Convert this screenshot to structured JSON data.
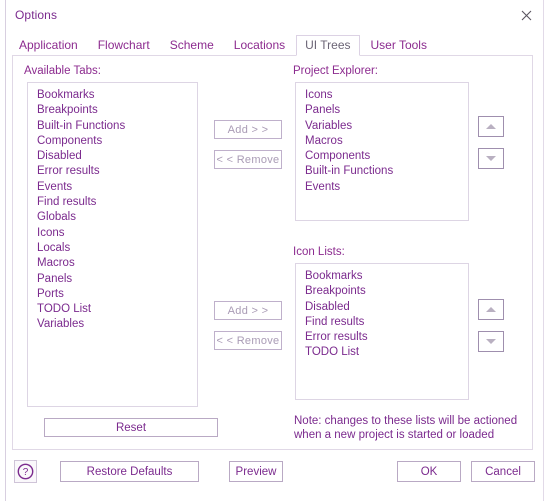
{
  "window": {
    "title": "Options",
    "close_icon": "close-icon"
  },
  "tabs": [
    {
      "label": "Application",
      "selected": false
    },
    {
      "label": "Flowchart",
      "selected": false
    },
    {
      "label": "Scheme",
      "selected": false
    },
    {
      "label": "Locations",
      "selected": false
    },
    {
      "label": "UI Trees",
      "selected": true
    },
    {
      "label": "User Tools",
      "selected": false
    }
  ],
  "available_tabs": {
    "label": "Available Tabs:",
    "items": [
      "Bookmarks",
      "Breakpoints",
      "Built-in Functions",
      "Components",
      "Disabled",
      "Error results",
      "Events",
      "Find results",
      "Globals",
      "Icons",
      "Locals",
      "Macros",
      "Panels",
      "Ports",
      "TODO List",
      "Variables"
    ],
    "reset_label": "Reset"
  },
  "project_explorer": {
    "label": "Project Explorer:",
    "items": [
      "Icons",
      "Panels",
      "Variables",
      "Macros",
      "Components",
      "Built-in Functions",
      "Events"
    ],
    "add_label": "Add > >",
    "remove_label": "< < Remove",
    "move_up_icon": "arrow-up-icon",
    "move_down_icon": "arrow-down-icon"
  },
  "icon_lists": {
    "label": "Icon Lists:",
    "items": [
      "Bookmarks",
      "Breakpoints",
      "Disabled",
      "Find results",
      "Error results",
      "TODO List"
    ],
    "add_label": "Add > >",
    "remove_label": "< < Remove",
    "move_up_icon": "arrow-up-icon",
    "move_down_icon": "arrow-down-icon"
  },
  "note": "Note: changes to these lists will be actioned\nwhen a new project is started or loaded",
  "footer": {
    "help_icon": "help-question-icon",
    "restore_defaults_label": "Restore Defaults",
    "preview_label": "Preview",
    "ok_label": "OK",
    "cancel_label": "Cancel"
  },
  "colors": {
    "accent_text": "#7b2a8e",
    "tab_text": "#8c2b8f",
    "selected_tab_text": "#6b6475",
    "disabled_button_text": "#a99bb5",
    "border": "#ddd5e4",
    "background": "#ffffff"
  }
}
